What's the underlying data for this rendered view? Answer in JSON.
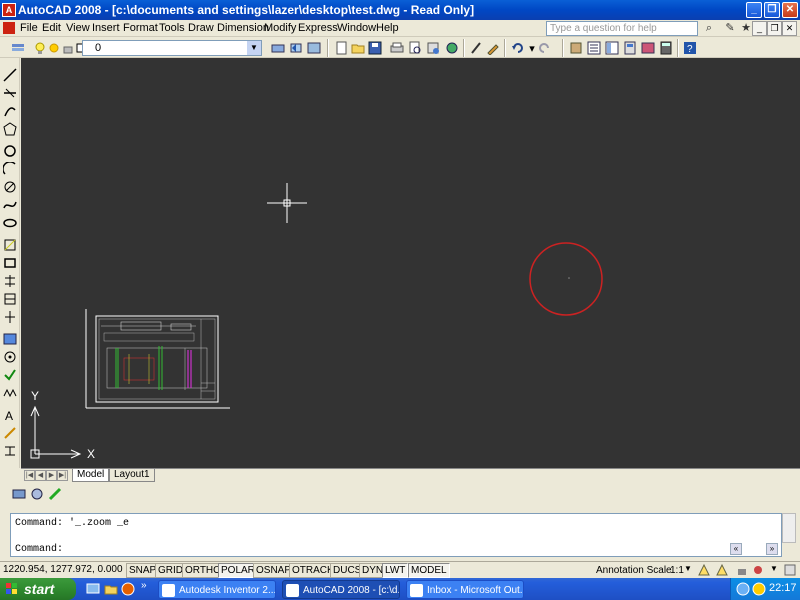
{
  "window": {
    "title": "AutoCAD 2008 - [c:\\documents and settings\\lazer\\desktop\\test.dwg - Read Only]",
    "app_icon": "A",
    "controls": [
      "_",
      "❐",
      "✕"
    ]
  },
  "menu": {
    "items": [
      "File",
      "Edit",
      "View",
      "Insert",
      "Format",
      "Tools",
      "Draw",
      "Dimension",
      "Modify",
      "Express",
      "Window",
      "Help"
    ],
    "search_placeholder": "Type a question for help"
  },
  "toolbar": {
    "layer_value": "0"
  },
  "layout_tabs": [
    "Model",
    "Layout1"
  ],
  "ucs": {
    "x_label": "X",
    "y_label": "Y"
  },
  "command": {
    "history": "Command: '_.zoom _e",
    "prompt": "Command:"
  },
  "status": {
    "coordinates": "1220.954, 1277.972, 0.000",
    "toggles": [
      "SNAP",
      "GRID",
      "ORTHO",
      "POLAR",
      "OSNAP",
      "OTRACK",
      "DUCS",
      "DYN",
      "LWT",
      "MODEL"
    ],
    "annotation_scale_label": "Annotation Scale:",
    "annotation_scale_value": "1:1"
  },
  "taskbar": {
    "start_label": "start",
    "tasks": [
      {
        "label": "Autodesk Inventor 2...",
        "active": false
      },
      {
        "label": "AutoCAD 2008 - [c:\\d...",
        "active": true
      },
      {
        "label": "Inbox - Microsoft Out...",
        "active": false
      }
    ],
    "clock": "22:17"
  },
  "colors": {
    "canvas": "#333333",
    "title_blue": "#0a5fd6",
    "cursor_circle": "#cc2222",
    "start_green": "#3c9a3c"
  }
}
